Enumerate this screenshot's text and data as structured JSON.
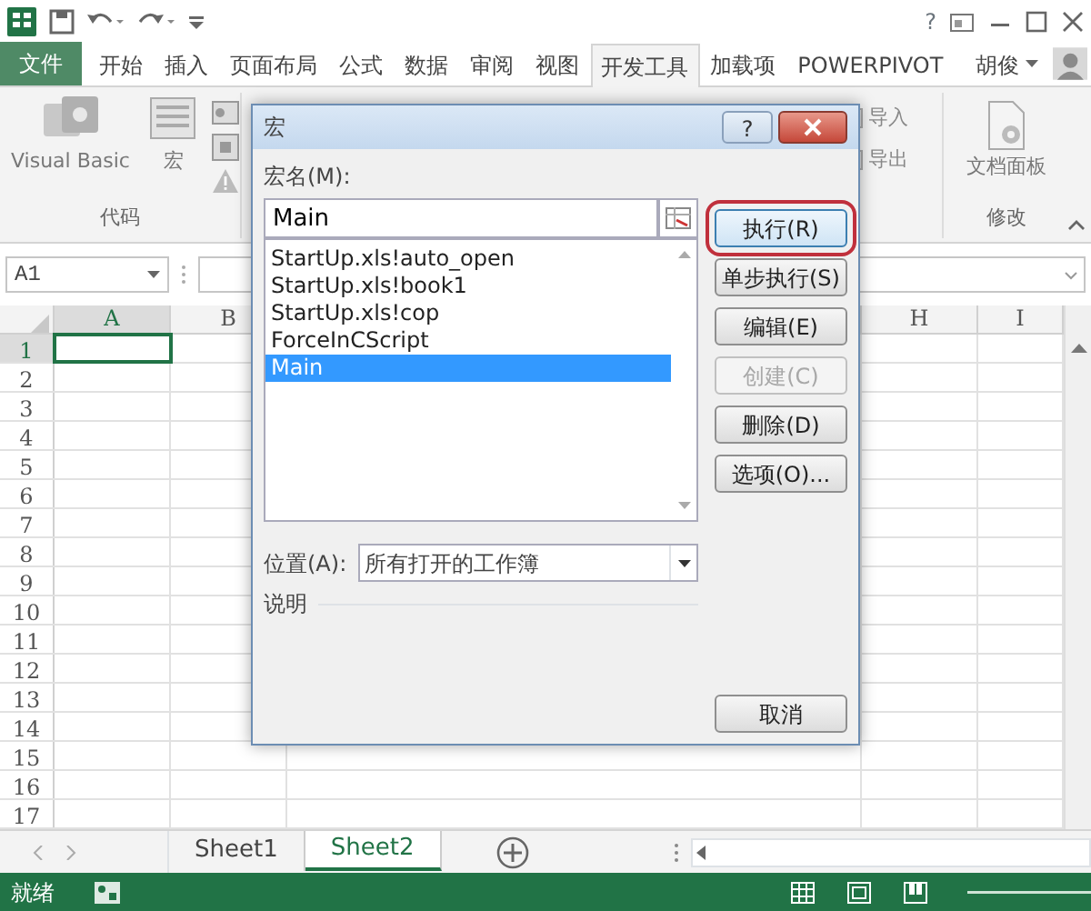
{
  "title_bar": {
    "help": "?"
  },
  "ribbon_tabs": [
    {
      "label": "文件",
      "kind": "file",
      "selected": false
    },
    {
      "label": "开始",
      "kind": "tab",
      "selected": false
    },
    {
      "label": "插入",
      "kind": "tab",
      "selected": false
    },
    {
      "label": "页面布局",
      "kind": "tab",
      "selected": false
    },
    {
      "label": "公式",
      "kind": "tab",
      "selected": false
    },
    {
      "label": "数据",
      "kind": "tab",
      "selected": false
    },
    {
      "label": "审阅",
      "kind": "tab",
      "selected": false
    },
    {
      "label": "视图",
      "kind": "tab",
      "selected": false
    },
    {
      "label": "开发工具",
      "kind": "tab",
      "selected": true
    },
    {
      "label": "加载项",
      "kind": "tab",
      "selected": false
    },
    {
      "label": "POWERPIVOT",
      "kind": "tab",
      "selected": false
    }
  ],
  "user": {
    "name": "胡俊"
  },
  "ribbon": {
    "code_group": {
      "label": "代码",
      "buttons": [
        "Visual Basic",
        "宏"
      ]
    },
    "xml_group": {
      "buttons": [
        "导入",
        "导出"
      ]
    },
    "modify_group": {
      "label": "修改",
      "buttons": [
        "文档面板"
      ]
    }
  },
  "name_box": "A1",
  "columns": [
    {
      "letter": "A",
      "selected": true
    },
    {
      "letter": "B",
      "selected": false
    },
    {
      "letter": "H",
      "selected": false
    },
    {
      "letter": "I",
      "selected": false
    }
  ],
  "rows": [
    {
      "label": "1",
      "selected": true
    },
    {
      "label": "2",
      "selected": false
    },
    {
      "label": "3",
      "selected": false
    },
    {
      "label": "4",
      "selected": false
    },
    {
      "label": "5",
      "selected": false
    },
    {
      "label": "6",
      "selected": false
    },
    {
      "label": "7",
      "selected": false
    },
    {
      "label": "8",
      "selected": false
    },
    {
      "label": "9",
      "selected": false
    },
    {
      "label": "10",
      "selected": false
    },
    {
      "label": "11",
      "selected": false
    },
    {
      "label": "12",
      "selected": false
    },
    {
      "label": "13",
      "selected": false
    },
    {
      "label": "14",
      "selected": false
    },
    {
      "label": "15",
      "selected": false
    },
    {
      "label": "16",
      "selected": false
    },
    {
      "label": "17",
      "selected": false
    }
  ],
  "sheets": [
    {
      "name": "Sheet1",
      "selected": false
    },
    {
      "name": "Sheet2",
      "selected": true
    }
  ],
  "status_bar": {
    "text": "就绪"
  },
  "dialog": {
    "title": "宏",
    "help": "?",
    "macro_name_label": "宏名(M):",
    "macro_name": "Main",
    "macros": [
      {
        "name": "StartUp.xls!auto_open",
        "selected": false
      },
      {
        "name": "StartUp.xls!book1",
        "selected": false
      },
      {
        "name": "StartUp.xls!cop",
        "selected": false
      },
      {
        "name": "ForceInCScript",
        "selected": false
      },
      {
        "name": "Main",
        "selected": true
      }
    ],
    "buttons": [
      {
        "label": "执行(R)",
        "kind": "action",
        "default": true,
        "disabled": false
      },
      {
        "label": "单步执行(S)",
        "kind": "action",
        "default": false,
        "disabled": false
      },
      {
        "label": "编辑(E)",
        "kind": "action",
        "default": false,
        "disabled": false
      },
      {
        "label": "创建(C)",
        "kind": "action",
        "default": false,
        "disabled": true
      },
      {
        "label": "删除(D)",
        "kind": "action",
        "default": false,
        "disabled": false
      },
      {
        "label": "选项(O)...",
        "kind": "action",
        "default": false,
        "disabled": false
      },
      {
        "label": "取消",
        "kind": "cancel",
        "default": false,
        "disabled": false
      }
    ],
    "location_label": "位置(A):",
    "location": "所有打开的工作簿",
    "description_label": "说明"
  }
}
